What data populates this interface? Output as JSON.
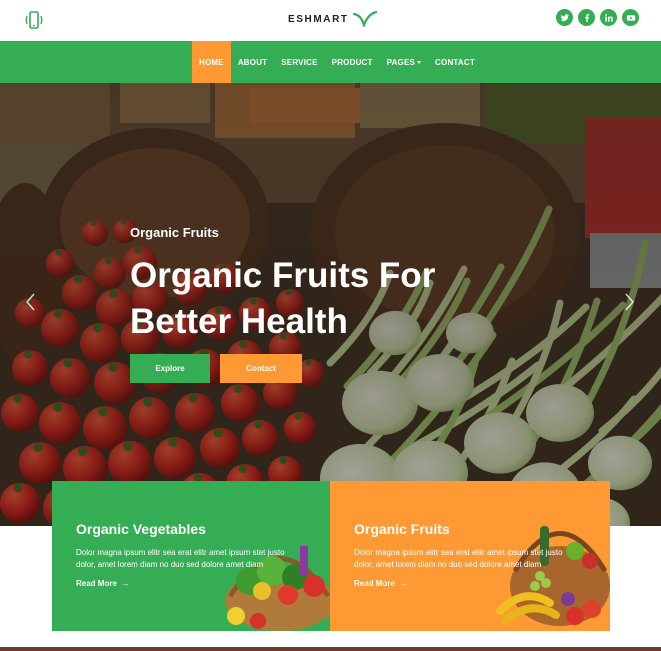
{
  "header": {
    "phone_icon": "phone-icon",
    "logo_text": "ESHMART",
    "socials": [
      {
        "name": "twitter-icon"
      },
      {
        "name": "facebook-icon"
      },
      {
        "name": "linkedin-icon"
      },
      {
        "name": "youtube-icon"
      }
    ]
  },
  "nav": {
    "items": [
      {
        "label": "HOME",
        "active": true
      },
      {
        "label": "ABOUT"
      },
      {
        "label": "SERVICE"
      },
      {
        "label": "PRODUCT"
      },
      {
        "label": "PAGES"
      },
      {
        "label": "CONTACT"
      }
    ]
  },
  "hero": {
    "subtitle": "Organic Fruits",
    "title": "Organic Fruits For Better Health",
    "explore_label": "Explore",
    "contact_label": "Contact"
  },
  "cards": [
    {
      "title": "Organic Vegetables",
      "text": "Dolor magna ipsum elitr sea erat elitr amet ipsum stet justo dolor, amet lorem diam no duo sed dolore amet diam",
      "link": "Read More"
    },
    {
      "title": "Organic Fruits",
      "text": "Dolor magna ipsum elitr sea erat elitr amet ipsum stet justo dolor, amet lorem diam no duo sed dolore amet diam",
      "link": "Read More"
    }
  ],
  "colors": {
    "green": "#34ad54",
    "orange": "#ff9933"
  }
}
